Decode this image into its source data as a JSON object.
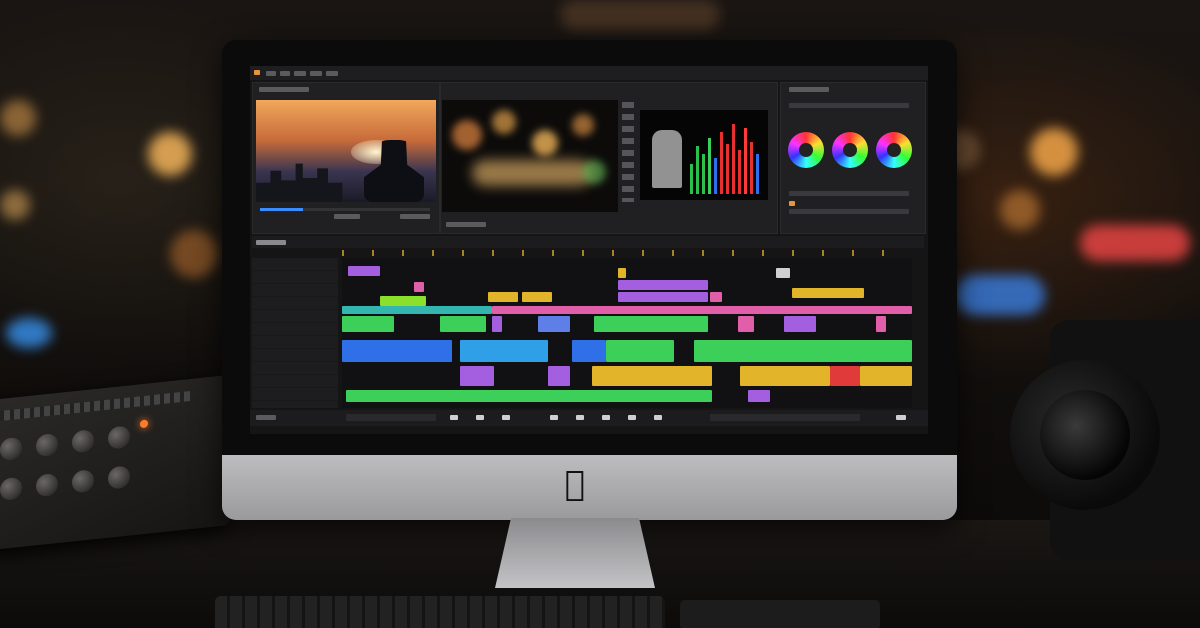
{
  "scene": {
    "subject": "",
    "brand_logo": "apple-logo"
  },
  "editor": {
    "menu_items": [
      "",
      "",
      "",
      "",
      ""
    ],
    "timecode_label": "",
    "track_count": 12
  },
  "colors": {
    "accent_orange": "#e8943a",
    "clip_purple": "#a45ee0",
    "clip_green": "#3ccf5a",
    "clip_blue": "#2f6fe8",
    "clip_yellow": "#e2b42a",
    "clip_teal": "#33b6b0",
    "clip_pink": "#e05fa8"
  }
}
